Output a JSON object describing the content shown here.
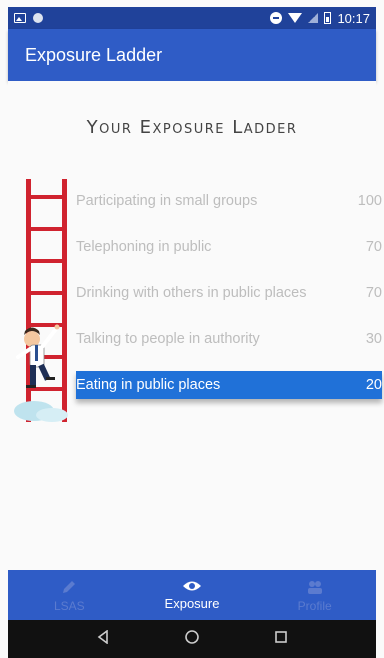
{
  "status_bar": {
    "time": "10:17"
  },
  "app_bar": {
    "title": "Exposure Ladder"
  },
  "heading": "Your Exposure Ladder",
  "steps": [
    {
      "label": "Participating in small groups",
      "value": "100",
      "active": false
    },
    {
      "label": "Telephoning in public",
      "value": "70",
      "active": false
    },
    {
      "label": "Drinking with others in public places",
      "value": "70",
      "active": false
    },
    {
      "label": "Talking to people in authority",
      "value": "30",
      "active": false
    },
    {
      "label": "Eating in public places",
      "value": "20",
      "active": true
    }
  ],
  "bottom_nav": [
    {
      "label": "LSAS",
      "icon": "pencil-icon",
      "active": false
    },
    {
      "label": "Exposure",
      "icon": "eye-icon",
      "active": true
    },
    {
      "label": "Profile",
      "icon": "profile-icon",
      "active": false
    }
  ],
  "colors": {
    "app_bar": "#2f5cc6",
    "status_bar": "#20429a",
    "active_step": "#2071d8",
    "ladder": "#d0232f"
  }
}
